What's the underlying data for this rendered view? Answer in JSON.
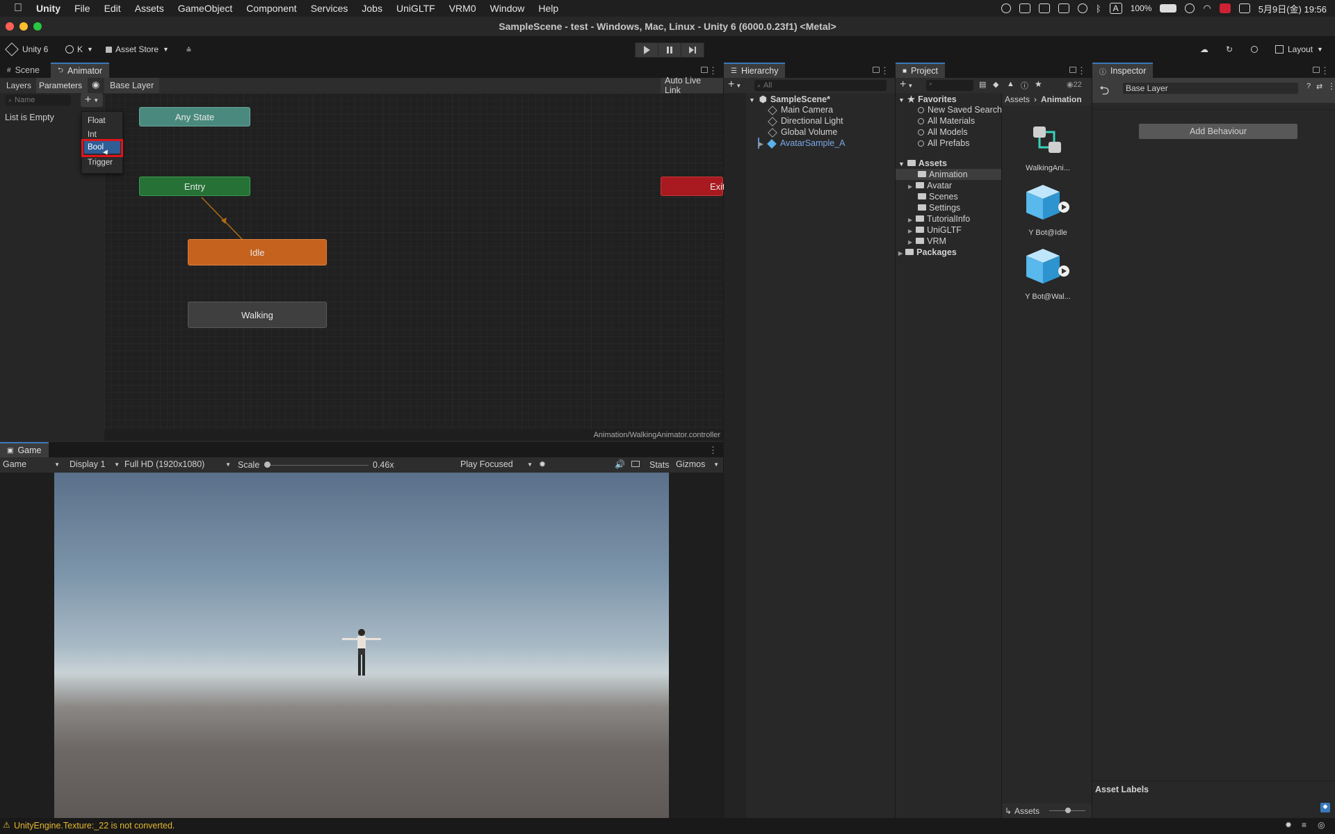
{
  "menubar": {
    "app": "Unity",
    "items": [
      "File",
      "Edit",
      "Assets",
      "GameObject",
      "Component",
      "Services",
      "Jobs",
      "UniGLTF",
      "VRM0",
      "Window",
      "Help"
    ],
    "battery": "100%",
    "input_method": "A",
    "datetime": "5月9日(金) 19:56"
  },
  "window": {
    "title": "SampleScene - test - Windows, Mac, Linux - Unity 6 (6000.0.23f1) <Metal>"
  },
  "toolbar": {
    "unity_label": "Unity 6",
    "account": "K",
    "asset_store": "Asset Store",
    "layout": "Layout"
  },
  "animator": {
    "tabs": [
      "Scene",
      "Animator"
    ],
    "subtabs": [
      "Layers",
      "Parameters"
    ],
    "breadcrumb": "Base Layer",
    "auto_live_link": "Auto Live Link",
    "search_placeholder": "Name",
    "list_empty": "List is Empty",
    "menu": [
      "Float",
      "Int",
      "Bool",
      "Trigger"
    ],
    "selected_menu": "Bool",
    "nodes": {
      "any_state": "Any State",
      "entry": "Entry",
      "exit": "Exit",
      "idle": "Idle",
      "walking": "Walking"
    },
    "footer": "Animation/WalkingAnimator.controller"
  },
  "game": {
    "tab": "Game",
    "mode": "Game",
    "display": "Display 1",
    "resolution": "Full HD (1920x1080)",
    "scale_label": "Scale",
    "scale_value": "0.46x",
    "play_focused": "Play Focused",
    "stats": "Stats",
    "gizmos": "Gizmos"
  },
  "hierarchy": {
    "tab": "Hierarchy",
    "search_placeholder": "All",
    "scene": "SampleScene*",
    "items": [
      "Main Camera",
      "Directional Light",
      "Global Volume",
      "AvatarSample_A"
    ]
  },
  "project": {
    "tab": "Project",
    "count": "22",
    "favorites_label": "Favorites",
    "favorites": [
      "New Saved Search",
      "All Materials",
      "All Models",
      "All Prefabs"
    ],
    "assets_label": "Assets",
    "folders": [
      "Animation",
      "Avatar",
      "Scenes",
      "Settings",
      "TutorialInfo",
      "UniGLTF",
      "VRM"
    ],
    "packages_label": "Packages",
    "breadcrumb": [
      "Assets",
      "Animation"
    ],
    "assets": [
      "WalkingAni...",
      "Y Bot@Idle",
      "Y Bot@Wal..."
    ],
    "footer_label": "Assets"
  },
  "inspector": {
    "tab": "Inspector",
    "name_field": "Base Layer",
    "add_behaviour": "Add Behaviour",
    "asset_labels": "Asset Labels"
  },
  "status": {
    "message": "UnityEngine.Texture:_22 is not converted."
  },
  "colors": {
    "accent": "#3a79bb",
    "any_state": "#4a8a7e",
    "entry": "#267236",
    "exit": "#a81a1f",
    "idle": "#c4621e",
    "walking": "#3f3f3f",
    "highlight_box": "#e0141a"
  }
}
